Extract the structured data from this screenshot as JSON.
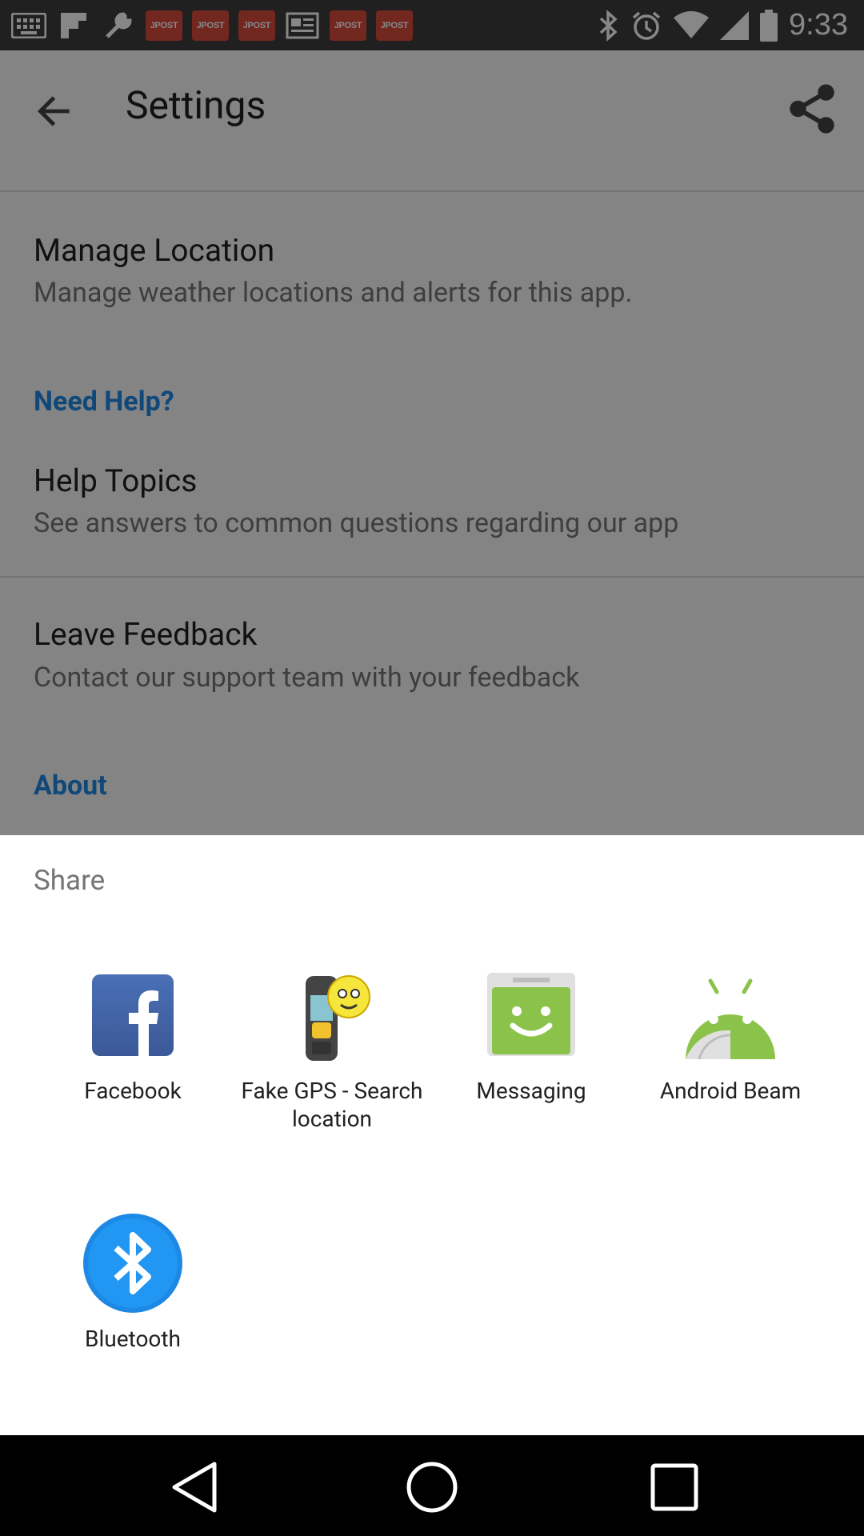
{
  "status_bar": {
    "time": "9:33",
    "notification_icons": [
      "keyboard-icon",
      "flipboard-icon",
      "tools-icon",
      "jpost-icon",
      "jpost-icon",
      "jpost-icon",
      "news-icon",
      "jpost-icon",
      "jpost-icon"
    ],
    "jpost_text": "JPOST",
    "system_icons": [
      "bluetooth-icon",
      "alarm-icon",
      "wifi-icon",
      "signal-icon",
      "battery-icon"
    ]
  },
  "app_bar": {
    "title": "Settings",
    "back_icon": "arrow-back-icon",
    "share_icon": "share-icon"
  },
  "settings": {
    "manage_location": {
      "title": "Manage Location",
      "subtitle": "Manage weather locations and alerts for this app."
    },
    "need_help_header": "Need Help?",
    "help_topics": {
      "title": "Help Topics",
      "subtitle": "See answers to common questions regarding our app"
    },
    "leave_feedback": {
      "title": "Leave Feedback",
      "subtitle": "Contact our support team with your feedback"
    },
    "about_header": "About"
  },
  "share_sheet": {
    "title": "Share",
    "apps": [
      {
        "label": "Facebook",
        "icon": "facebook-icon"
      },
      {
        "label": "Fake GPS - Search location",
        "icon": "fake-gps-icon"
      },
      {
        "label": "Messaging",
        "icon": "messaging-icon"
      },
      {
        "label": "Android Beam",
        "icon": "android-beam-icon"
      },
      {
        "label": "Bluetooth",
        "icon": "bluetooth-icon"
      }
    ]
  },
  "colors": {
    "accent": "#1E88E5",
    "facebook": "#3B5998",
    "messaging": "#8BC34A",
    "android": "#8BC34A",
    "bluetooth": "#1E88E5"
  }
}
